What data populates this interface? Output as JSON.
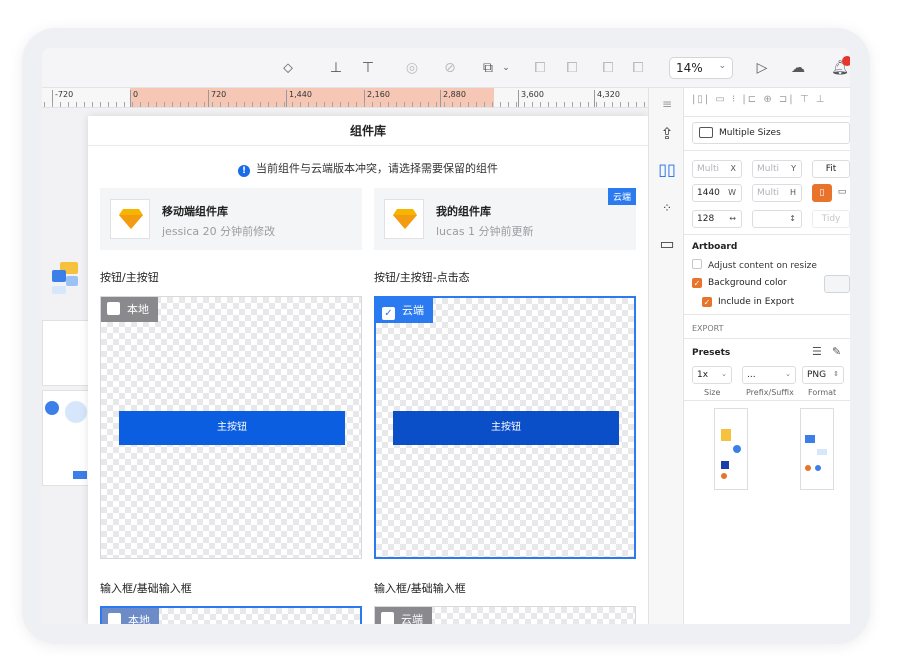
{
  "toolbar": {
    "zoom": "14%",
    "zoom_caret": "⌄"
  },
  "ruler": {
    "ticks": [
      "-720",
      "0",
      "720",
      "1,440",
      "2,160",
      "2,880",
      "3,600",
      "4,320"
    ]
  },
  "dialog": {
    "title": "组件库",
    "notice": "当前组件与云端版本冲突，请选择需要保留的组件",
    "local_lib": {
      "name": "移动端组件库",
      "meta": "jessica 20 分钟前修改"
    },
    "cloud_lib": {
      "name": "我的组件库",
      "meta": "lucas 1 分钟前更新",
      "tag": "云端"
    },
    "sections": [
      {
        "left_label": "按钮/主按钮",
        "right_label": "按钮/主按钮-点击态",
        "left_tag": "本地",
        "right_tag": "云端",
        "left_button": "主按钮",
        "right_button": "主按钮",
        "left_button_color": "#0b5ee0",
        "right_button_color": "#0a4fc7"
      },
      {
        "left_label": "输入框/基础输入框",
        "right_label": "输入框/基础输入框",
        "left_tag": "本地",
        "right_tag": "云端"
      }
    ]
  },
  "inspector": {
    "multi_sizes": "Multiple Sizes",
    "fields": {
      "x": "Multi",
      "x_sfx": "X",
      "y": "Multi",
      "y_sfx": "Y",
      "fit": "Fit",
      "w": "1440",
      "w_sfx": "W",
      "h": "Multi",
      "h_sfx": "H",
      "r": "128",
      "tidy": "Tidy"
    },
    "artboard": {
      "title": "Artboard",
      "adjust": "Adjust content on resize",
      "bg": "Background color",
      "include": "Include in Export"
    },
    "export": {
      "title": "EXPORT",
      "presets": "Presets",
      "size_val": "1x",
      "prefix_val": "...",
      "format_val": "PNG",
      "size_label": "Size",
      "prefix_label": "Prefix/Suffix",
      "format_label": "Format"
    }
  },
  "colors": {
    "accent_blue": "#2b7af0",
    "orange": "#e8742c",
    "ruler_highlight": "#f6c7b5"
  }
}
